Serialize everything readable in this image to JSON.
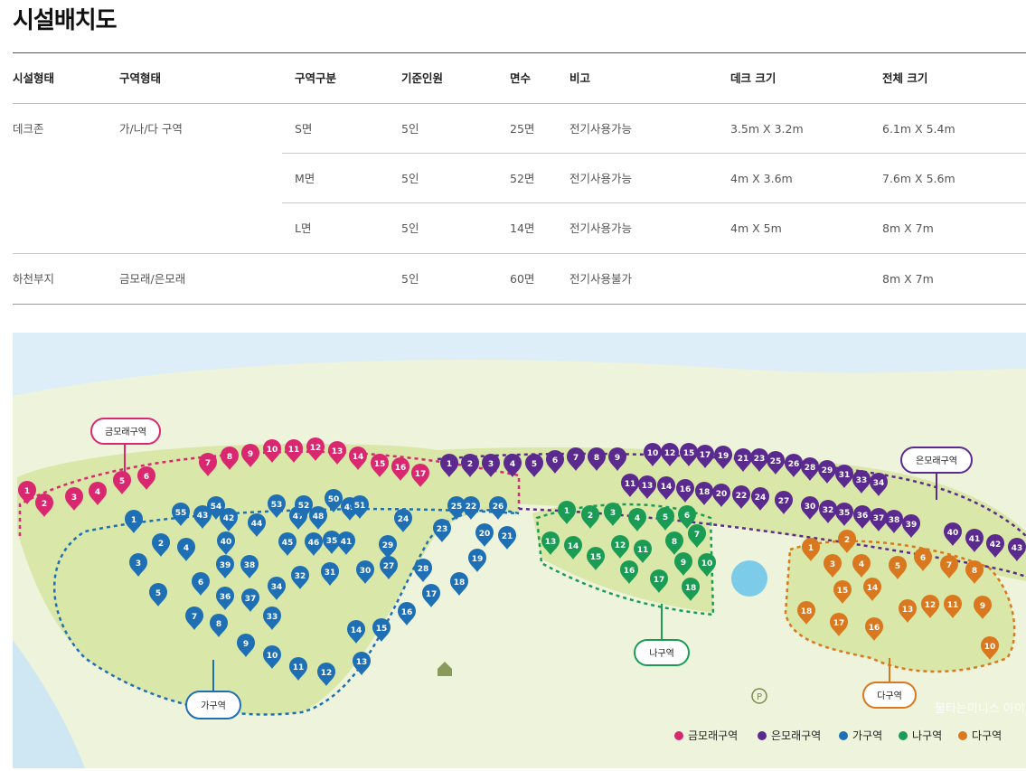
{
  "page": {
    "title": "시설배치도"
  },
  "table": {
    "headers": [
      "시설형태",
      "구역형태",
      "구역구분",
      "기준인원",
      "면수",
      "비고",
      "데크 크기",
      "전체 크기"
    ],
    "rows": [
      {
        "facility": "데크존",
        "zone_type": "가/나/다 구역",
        "division": "S면",
        "capacity": "5인",
        "count": "25면",
        "note": "전기사용가능",
        "deck_size": "3.5m X 3.2m",
        "total_size": "6.1m X 5.4m"
      },
      {
        "facility": "",
        "zone_type": "",
        "division": "M면",
        "capacity": "5인",
        "count": "52면",
        "note": "전기사용가능",
        "deck_size": "4m X 3.6m",
        "total_size": "7.6m X 5.6m"
      },
      {
        "facility": "",
        "zone_type": "",
        "division": "L면",
        "capacity": "5인",
        "count": "14면",
        "note": "전기사용가능",
        "deck_size": "4m X 5m",
        "total_size": "8m X 7m"
      },
      {
        "facility": "하천부지",
        "zone_type": "금모래/은모래",
        "division": "",
        "capacity": "5인",
        "count": "60면",
        "note": "전기사용불가",
        "deck_size": "",
        "total_size": "8m X 7m"
      }
    ]
  },
  "map": {
    "zone_labels": {
      "geum": "금모래구역",
      "eun": "은모래구역",
      "ga": "가구역",
      "na": "나구역",
      "da": "다구역"
    },
    "colors": {
      "geum": "#d9286f",
      "eun": "#5b2a8f",
      "ga": "#1f6fb5",
      "na": "#1a9c55",
      "da": "#d9781e"
    },
    "pins": {
      "geum": [
        "1",
        "2",
        "3",
        "4",
        "5",
        "6",
        "7",
        "8",
        "9",
        "10",
        "11",
        "12",
        "13",
        "14",
        "15",
        "16",
        "17"
      ],
      "eun": [
        "1",
        "2",
        "3",
        "4",
        "5",
        "6",
        "7",
        "8",
        "9",
        "10",
        "12",
        "15",
        "17",
        "19",
        "21",
        "23",
        "25",
        "26",
        "28",
        "29",
        "31",
        "33",
        "34",
        "11",
        "13",
        "14",
        "16",
        "18",
        "20",
        "22",
        "24",
        "27",
        "30",
        "32",
        "35",
        "36",
        "37",
        "38",
        "39",
        "40",
        "41",
        "42",
        "43"
      ],
      "ga": [
        "1",
        "2",
        "3",
        "4",
        "5",
        "6",
        "7",
        "8",
        "9",
        "10",
        "11",
        "12",
        "13",
        "14",
        "15",
        "16",
        "17",
        "18",
        "19",
        "20",
        "21",
        "22",
        "23",
        "24",
        "25",
        "26",
        "27",
        "28",
        "29",
        "30",
        "31",
        "32",
        "33",
        "34",
        "35",
        "36",
        "37",
        "38",
        "39",
        "40",
        "41",
        "42",
        "43",
        "44",
        "45",
        "46",
        "47",
        "48",
        "49",
        "50",
        "51",
        "52",
        "53",
        "54",
        "55"
      ],
      "na": [
        "1",
        "2",
        "3",
        "4",
        "5",
        "6",
        "7",
        "8",
        "9",
        "10",
        "11",
        "12",
        "13",
        "14",
        "15",
        "16",
        "17",
        "18"
      ],
      "da": [
        "1",
        "2",
        "3",
        "4",
        "5",
        "6",
        "7",
        "8",
        "9",
        "10",
        "11",
        "12",
        "13",
        "14",
        "15",
        "16",
        "17",
        "18"
      ]
    },
    "parking_symbol": "P",
    "watermark": "불타는미니스 아이",
    "legend": [
      {
        "key": "geum",
        "label": "금모래구역"
      },
      {
        "key": "eun",
        "label": "은모래구역"
      },
      {
        "key": "ga",
        "label": "가구역"
      },
      {
        "key": "na",
        "label": "나구역"
      },
      {
        "key": "da",
        "label": "다구역"
      }
    ]
  }
}
